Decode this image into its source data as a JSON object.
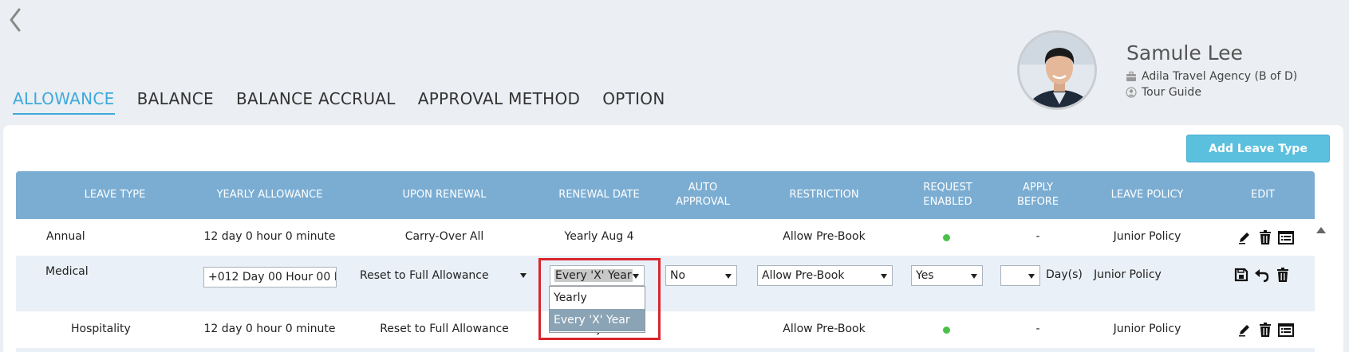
{
  "profile": {
    "name": "Samule Lee",
    "organization": "Adila Travel Agency (B of D)",
    "role": "Tour Guide"
  },
  "tabs": [
    "ALLOWANCE",
    "BALANCE",
    "BALANCE ACCRUAL",
    "APPROVAL METHOD",
    "OPTION"
  ],
  "active_tab": "ALLOWANCE",
  "add_button_label": "Add Leave Type",
  "columns": {
    "leave_type": "LEAVE TYPE",
    "yearly_allowance": "YEARLY ALLOWANCE",
    "upon_renewal": "UPON RENEWAL",
    "renewal_date": "RENEWAL DATE",
    "auto_approval_1": "AUTO",
    "auto_approval_2": "APPROVAL",
    "restriction": "RESTRICTION",
    "request_enabled_1": "REQUEST",
    "request_enabled_2": "ENABLED",
    "apply_before_1": "APPLY",
    "apply_before_2": "BEFORE",
    "leave_policy": "LEAVE POLICY",
    "edit": "EDIT"
  },
  "rows": {
    "annual": {
      "leave_type": "Annual",
      "yearly_allowance": "12 day 0 hour 0 minute",
      "upon_renewal": "Carry-Over All",
      "renewal_date": "Yearly Aug 4",
      "restriction": "Allow Pre-Book",
      "request_enabled": true,
      "apply_before": "-",
      "leave_policy": "Junior Policy"
    },
    "medical": {
      "leave_type": "Medical",
      "yearly_allowance_value": "+012 Day 00 Hour 00 Mi",
      "upon_renewal_value": "Reset to Full Allowance",
      "renewal_date_value": "Every 'X' Year",
      "auto_approval_value": "No",
      "restriction_value": "Allow Pre-Book",
      "request_enabled_value": "Yes",
      "apply_before_value": "",
      "apply_before_unit": "Day(s)",
      "leave_policy": "Junior Policy"
    },
    "hospitality": {
      "leave_type": "Hospitality",
      "yearly_allowance": "12 day 0 hour 0 minute",
      "upon_renewal": "Reset to Full Allowance",
      "renewal_date_partial": "ly",
      "restriction": "Allow Pre-Book",
      "request_enabled": true,
      "apply_before": "-",
      "leave_policy": "Junior Policy"
    }
  },
  "renewal_dropdown": {
    "options": [
      "Yearly",
      "Every 'X' Year"
    ],
    "selected": "Every 'X' Year"
  },
  "colors": {
    "accent": "#3fa9dc",
    "header": "#7badd2",
    "button": "#5bc0de",
    "highlight_border": "#d9262c",
    "enabled_dot": "#4cc04a"
  }
}
